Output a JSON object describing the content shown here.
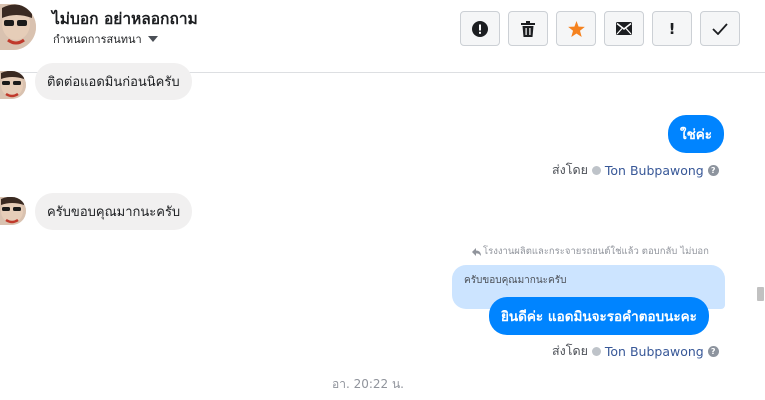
{
  "header": {
    "title": "ไม่บอก อย่าหลอกถาม",
    "subtitle": "กำหนดการสนทนา",
    "toolbar": {
      "spam_label": "!",
      "star_color": "#f5821f"
    }
  },
  "messages": [
    {
      "direction": "in",
      "text": "ติดต่อแอดมินก่อนนิครับ"
    },
    {
      "direction": "out",
      "text": "ใช่ค่ะ",
      "sent_by_label": "ส่งโดย",
      "sender": "Ton Bubpawong"
    },
    {
      "direction": "in",
      "text": "ครับขอบคุณมากนะครับ"
    },
    {
      "direction": "out",
      "reply_meta": "โรงงานผลิตและกระจายรถยนต์ใช่แล้ว ตอบกลับ ไม่บอก",
      "quoted": "ครับขอบคุณมากนะครับ",
      "text": "ยินดีค่ะ แอดมินจะรอคำตอบนะคะ",
      "sent_by_label": "ส่งโดย",
      "sender": "Ton Bubpawong"
    }
  ],
  "timestamp": "อา. 20:22 น.",
  "colors": {
    "accent": "#0084ff",
    "incoming_bubble": "#f1f0f0",
    "quoted_bubble": "#cce4ff",
    "sender_link": "#385898"
  }
}
